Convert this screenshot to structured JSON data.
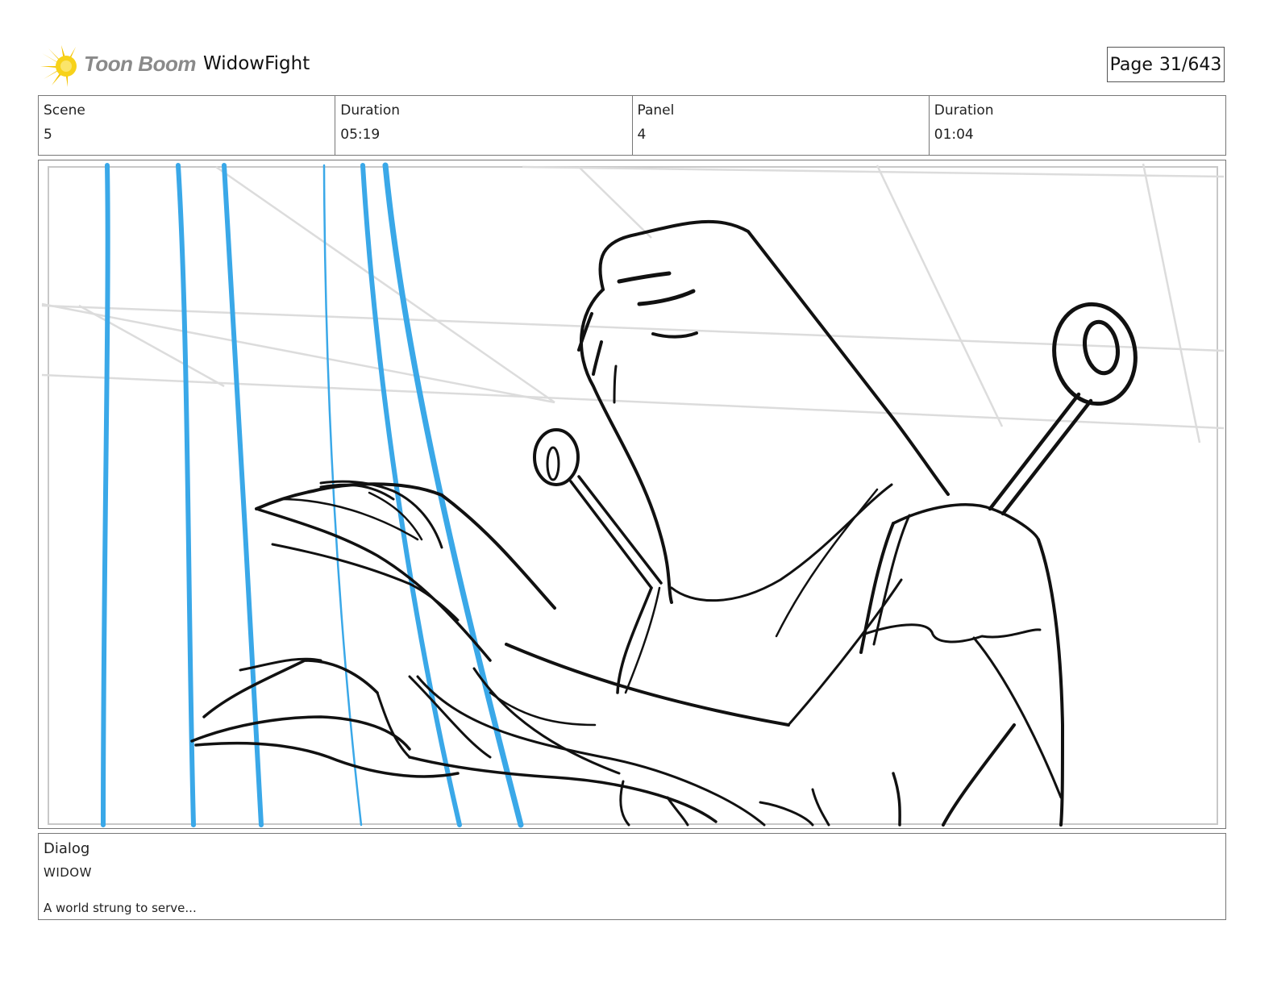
{
  "header": {
    "logo_text": "Toon Boom",
    "project_title": "WidowFight",
    "page_label": "Page",
    "page_value": "31/643"
  },
  "info": {
    "scene_label": "Scene",
    "scene_value": "5",
    "scene_duration_label": "Duration",
    "scene_duration_value": "05:19",
    "panel_label": "Panel",
    "panel_value": "4",
    "panel_duration_label": "Duration",
    "panel_duration_value": "01:04"
  },
  "dialog": {
    "label": "Dialog",
    "speaker": "WIDOW",
    "line": "A world strung to serve..."
  },
  "colors": {
    "string_blue": "#3aa8e8",
    "ink": "#111111",
    "guide_gray": "#d9d9d9",
    "logo_yellow": "#f5c400"
  }
}
